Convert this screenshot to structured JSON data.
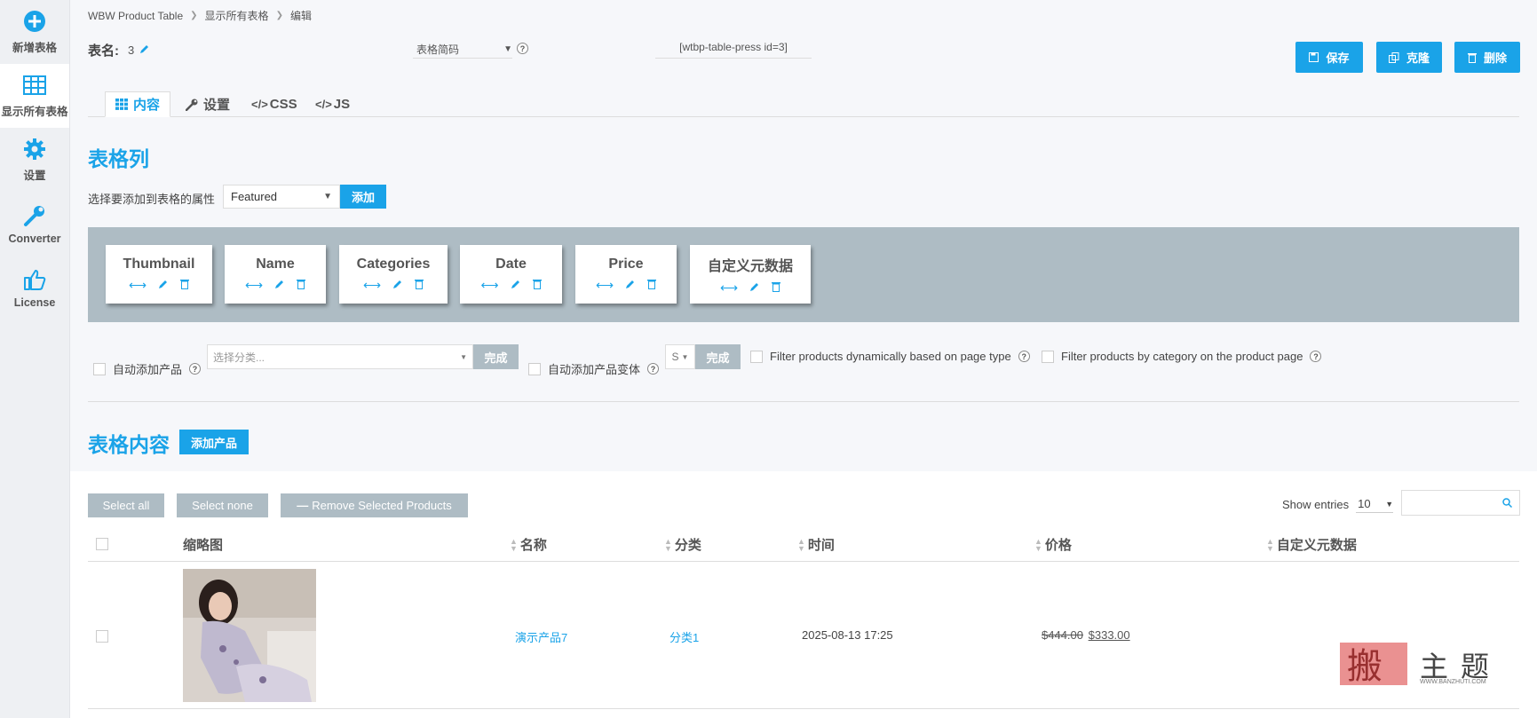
{
  "sidebar": {
    "items": [
      {
        "label": "新增表格",
        "icon": "plus-circle-icon"
      },
      {
        "label": "显示所有表格",
        "icon": "table-grid-icon"
      },
      {
        "label": "设置",
        "icon": "gear-icon"
      },
      {
        "label": "Converter",
        "icon": "wrench-icon"
      },
      {
        "label": "License",
        "icon": "thumbs-up-icon"
      }
    ]
  },
  "breadcrumb": [
    "WBW Product Table",
    "显示所有表格",
    "编辑"
  ],
  "header": {
    "table_name_label": "表名:",
    "table_name_value": "3",
    "shortcode_select": "表格简码",
    "shortcode_text": "[wtbp-table-press id=3]",
    "save_label": "保存",
    "clone_label": "克隆",
    "delete_label": "删除"
  },
  "tabs": [
    {
      "label": "内容",
      "icon": "grid-icon"
    },
    {
      "label": "设置",
      "icon": "wrench-icon"
    },
    {
      "label": "CSS",
      "icon": "code-icon"
    },
    {
      "label": "JS",
      "icon": "code-icon"
    }
  ],
  "columns_section": {
    "title": "表格列",
    "attr_label": "选择要添加到表格的属性",
    "attr_value": "Featured",
    "add_label": "添加",
    "columns": [
      "Thumbnail",
      "Name",
      "Categories",
      "Date",
      "Price",
      "自定义元数据"
    ]
  },
  "options": {
    "auto_add_product": "自动添加产品",
    "category_placeholder": "选择分类...",
    "done_label": "完成",
    "auto_add_variation": "自动添加产品变体",
    "s_value": "S",
    "done_label_2": "完成",
    "filter_dynamic": "Filter products dynamically based on page type",
    "filter_category": "Filter products by category on the product page"
  },
  "content_section": {
    "title": "表格内容",
    "add_product_label": "添加产品",
    "select_all": "Select all",
    "select_none": "Select none",
    "remove_selected": "Remove Selected Products",
    "show_entries_label": "Show entries",
    "entries_value": "10",
    "headers": [
      "缩略图",
      "名称",
      "分类",
      "时间",
      "价格",
      "自定义元数据"
    ],
    "rows": [
      {
        "name": "演示产品7",
        "category": "分类1",
        "date": "2025-08-13 17:25",
        "old_price": "$444.00",
        "price": "$333.00"
      }
    ]
  },
  "watermark": {
    "main": "主题",
    "url": "WWW.BANZHUTI.COM"
  },
  "colors": {
    "accent": "#1aa3e8",
    "gray_button": "#aebcc4",
    "sidebar_bg": "#eef0f3"
  }
}
